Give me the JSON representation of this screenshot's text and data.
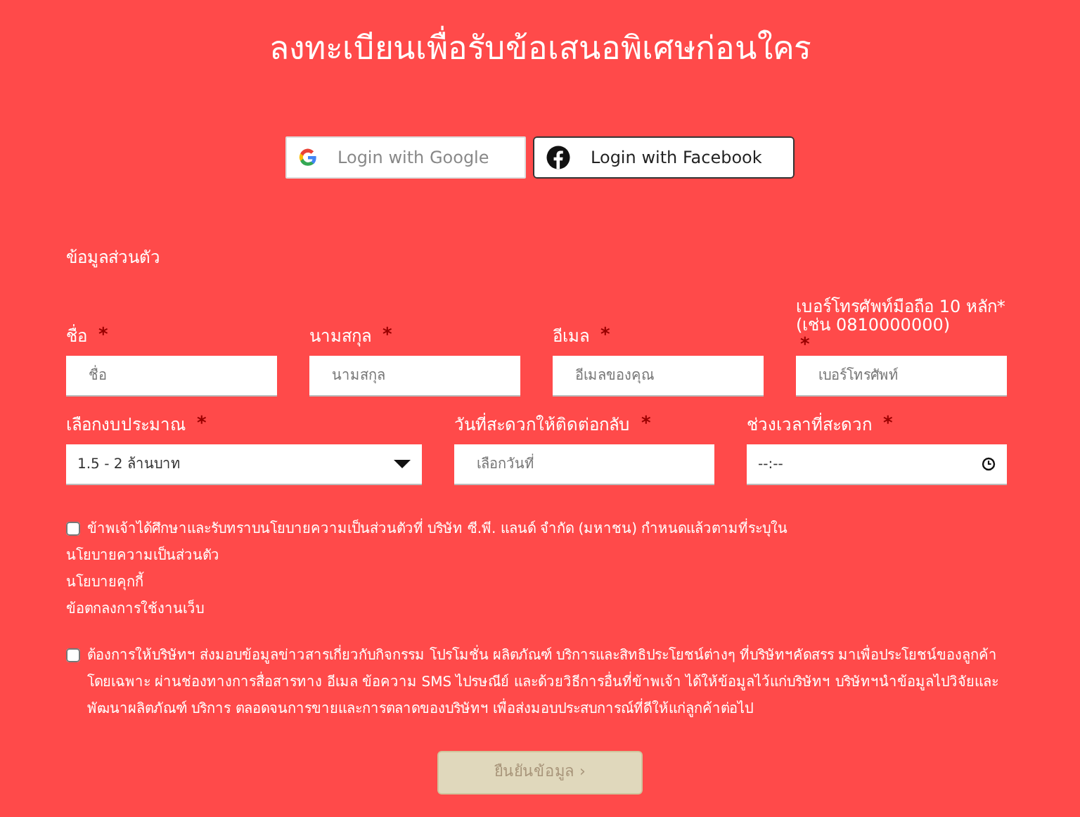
{
  "title": "ลงทะเบียนเพื่อรับข้อเสนอพิเศษก่อนใคร",
  "social_buttons": [
    {
      "kind": "google",
      "label": "Login with Google"
    },
    {
      "kind": "facebook",
      "label": "Login with Facebook"
    }
  ],
  "section_title": "ข้อมูลส่วนตัว",
  "fields_row_1": [
    {
      "label": "ชื่อ",
      "required_mark": "*",
      "placeholder": "ชื่อ"
    },
    {
      "label": "นามสกุล",
      "required_mark": "*",
      "placeholder": "นามสกุล"
    },
    {
      "label": "อีเมล",
      "required_mark": "*",
      "placeholder": "อีเมลของคุณ"
    },
    {
      "label": "เบอร์โทรศัพท์มือถือ 10 หลัก* (เช่น 0810000000)",
      "required_mark": "*",
      "placeholder": "เบอร์โทรศัพท์",
      "kind": "tall"
    }
  ],
  "fields_row_2": [
    {
      "kind": "select",
      "label": "เลือกงบประมาณ",
      "required_mark": "*",
      "value": "1.5 - 2 ล้านบาท"
    },
    {
      "kind": "date",
      "label": "วันที่สะดวกให้ติดต่อกลับ",
      "required_mark": "*",
      "placeholder": "เลือกวันที่"
    },
    {
      "kind": "time",
      "label": "ช่วงเวลาที่สะดวก",
      "required_mark": "*",
      "value": "--:--"
    }
  ],
  "consents": [
    {
      "checked": false,
      "text": "ข้าพเจ้าได้ศึกษาและรับทราบนโยบายความเป็นส่วนตัวที่ บริษัท ซี.พี. แลนด์ จำกัด (มหาชน) กำหนดแล้วตามที่ระบุใน",
      "links": [
        "นโยบายความเป็นส่วนตัว",
        "นโยบายคุกกี้",
        "ข้อตกลงการใช้งานเว็บ"
      ]
    },
    {
      "checked": false,
      "text": "ต้องการให้บริษัทฯ ส่งมอบข้อมูลข่าวสารเกี่ยวกับกิจกรรม โปรโมชั่น ผลิตภัณฑ์ บริการและสิทธิประโยชน์ต่างๆ ที่บริษัทฯคัดสรร มาเพื่อประโยชน์ของลูกค้าโดยเฉพาะ ผ่านช่องทางการสื่อสารทาง อีเมล ข้อความ SMS ไปรษณีย์ และด้วยวิธีการอื่นที่ข้าพเจ้า ได้ให้ข้อมูลไว้แก่บริษัทฯ บริษัทฯนำข้อมูลไปวิจัยและพัฒนาผลิตภัณฑ์ บริการ ตลอดจนการขายและการตลาดของบริษัทฯ เพื่อส่งมอบประสบการณ์ที่ดีให้แก่ลูกค้าต่อไป"
    }
  ],
  "submit": {
    "label": "ยืนยันข้อมูล ›",
    "disabled": true
  }
}
